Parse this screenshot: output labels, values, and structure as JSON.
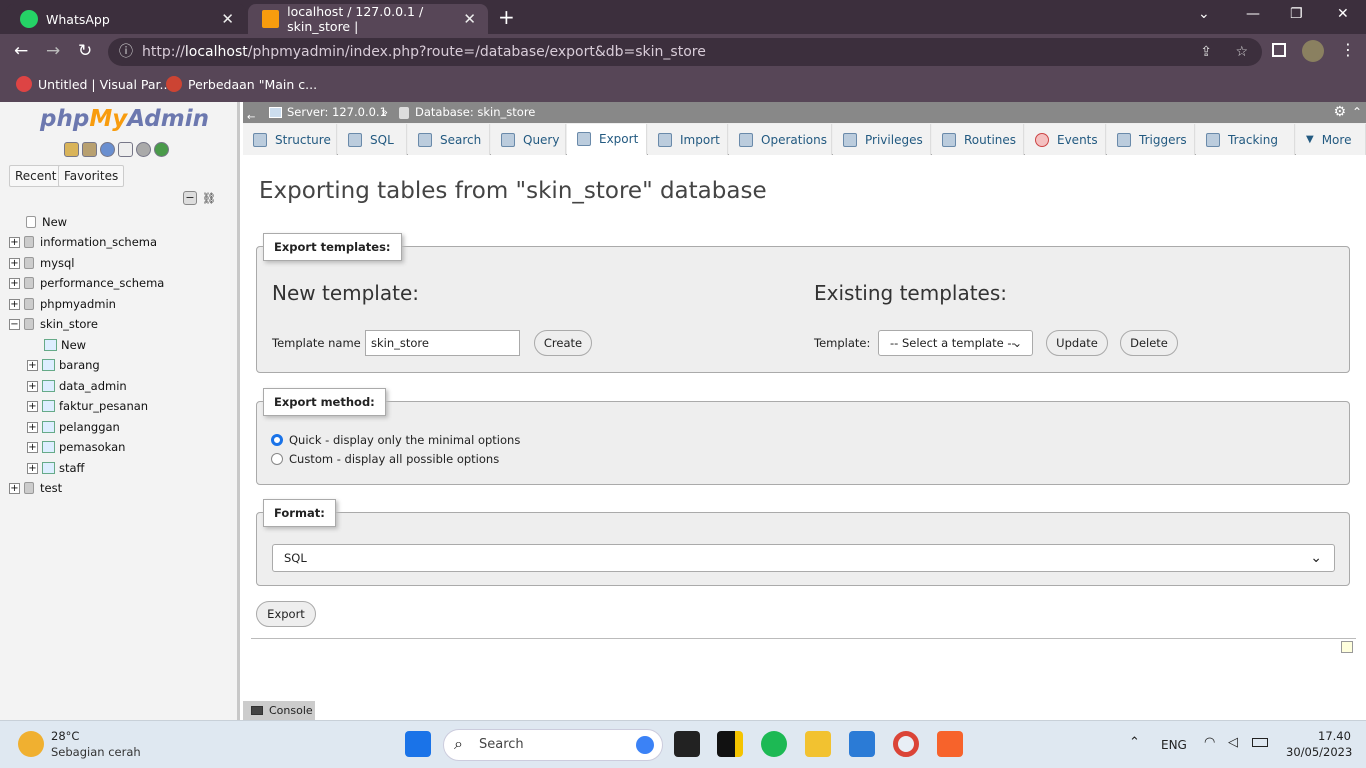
{
  "browser": {
    "tabs": [
      {
        "title": "WhatsApp"
      },
      {
        "title": "localhost / 127.0.0.1 / skin_store |"
      }
    ],
    "url_prefix": "http://",
    "url_host": "localhost",
    "url_path": "/phpmyadmin/index.php?route=/database/export&db=skin_store",
    "bookmarks": [
      "Untitled | Visual Par...",
      "Perbedaan \"Main c..."
    ]
  },
  "sidebar": {
    "logo_php": "php",
    "logo_my": "My",
    "logo_admin": "Admin",
    "tabs": [
      "Recent",
      "Favorites"
    ],
    "tree": [
      {
        "label": "New"
      },
      {
        "label": "information_schema"
      },
      {
        "label": "mysql"
      },
      {
        "label": "performance_schema"
      },
      {
        "label": "phpmyadmin"
      },
      {
        "label": "skin_store"
      },
      {
        "label": "New"
      },
      {
        "label": "barang"
      },
      {
        "label": "data_admin"
      },
      {
        "label": "faktur_pesanan"
      },
      {
        "label": "pelanggan"
      },
      {
        "label": "pemasokan"
      },
      {
        "label": "staff"
      },
      {
        "label": "test"
      }
    ]
  },
  "topbar": {
    "server": "Server: 127.0.0.1",
    "sep": "»",
    "database": "Database: skin_store"
  },
  "tabs": [
    {
      "label": "Structure"
    },
    {
      "label": "SQL"
    },
    {
      "label": "Search"
    },
    {
      "label": "Query"
    },
    {
      "label": "Export"
    },
    {
      "label": "Import"
    },
    {
      "label": "Operations"
    },
    {
      "label": "Privileges"
    },
    {
      "label": "Routines"
    },
    {
      "label": "Events"
    },
    {
      "label": "Triggers"
    },
    {
      "label": "Tracking"
    },
    {
      "label": "More"
    }
  ],
  "main": {
    "title": "Exporting tables from \"skin_store\" database",
    "export_templates": {
      "legend": "Export templates:",
      "new_heading": "New template:",
      "template_name_label": "Template name",
      "template_name_value": "skin_store",
      "create": "Create",
      "existing_heading": "Existing templates:",
      "template_label": "Template:",
      "template_select": "-- Select a template --",
      "update": "Update",
      "delete": "Delete"
    },
    "export_method": {
      "legend": "Export method:",
      "quick": "Quick - display only the minimal options",
      "custom": "Custom - display all possible options"
    },
    "format": {
      "legend": "Format:",
      "value": "SQL"
    },
    "export_button": "Export",
    "console": "Console"
  },
  "taskbar": {
    "temp": "28°C",
    "weather": "Sebagian cerah",
    "search": "Search",
    "lang": "ENG",
    "time": "17.40",
    "date": "30/05/2023"
  }
}
